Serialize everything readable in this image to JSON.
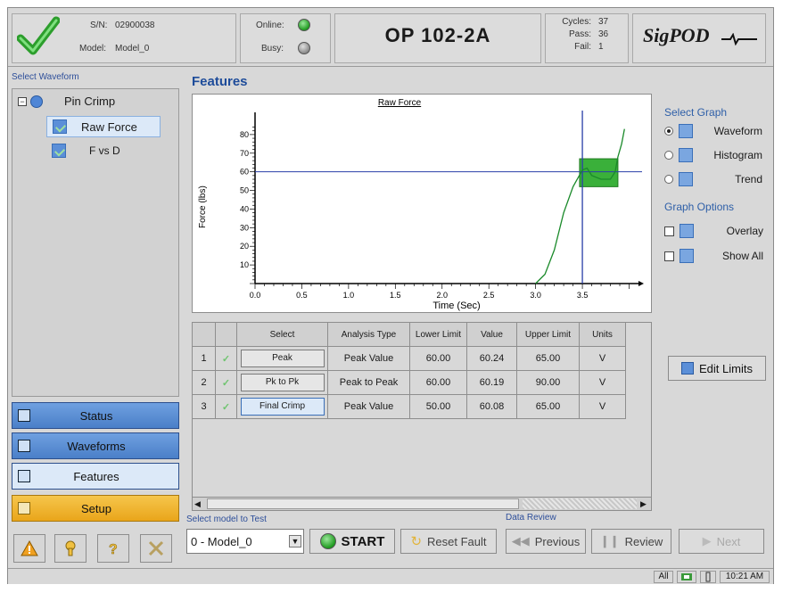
{
  "header": {
    "serial_label": "S/N:",
    "serial_value": "02900038",
    "model_label": "Model:",
    "model_value": "Model_0",
    "online_label": "Online:",
    "busy_label": "Busy:",
    "station_title": "OP 102-2A",
    "cycles_label": "Cycles:",
    "cycles_value": "37",
    "pass_label": "Pass:",
    "pass_value": "36",
    "fail_label": "Fail:",
    "fail_value": "1",
    "logo_text": "SigPOD"
  },
  "sidebar": {
    "select_waveform_label": "Select Waveform",
    "tree": {
      "root": "Pin Crimp",
      "items": [
        "Raw Force",
        "F vs D"
      ]
    },
    "nav": {
      "status": "Status",
      "waveforms": "Waveforms",
      "features": "Features",
      "setup": "Setup"
    }
  },
  "main": {
    "title": "Features",
    "graph_options": {
      "select_graph_label": "Select Graph",
      "waveform": "Waveform",
      "histogram": "Histogram",
      "trend": "Trend",
      "graph_options_label": "Graph Options",
      "overlay": "Overlay",
      "show_all": "Show All"
    },
    "table": {
      "headers": [
        "Select",
        "Analysis Type",
        "Lower Limit",
        "Value",
        "Upper Limit",
        "Units"
      ],
      "rows": [
        {
          "n": "1",
          "select": "Peak",
          "type": "Peak Value",
          "lower": "60.00",
          "value": "60.24",
          "upper": "65.00",
          "units": "V"
        },
        {
          "n": "2",
          "select": "Pk to Pk",
          "type": "Peak to Peak",
          "lower": "60.00",
          "value": "60.19",
          "upper": "90.00",
          "units": "V"
        },
        {
          "n": "3",
          "select": "Final Crimp",
          "type": "Peak Value",
          "lower": "50.00",
          "value": "60.08",
          "upper": "65.00",
          "units": "V"
        }
      ]
    },
    "edit_limits": "Edit Limits"
  },
  "bottom": {
    "select_model_label": "Select model to Test",
    "model_selected": "0 - Model_0",
    "start": "START",
    "reset_fault": "Reset Fault",
    "data_review_label": "Data Review",
    "previous": "Previous",
    "review": "Review",
    "next": "Next"
  },
  "statusbar": {
    "mode": "All",
    "time": "10:21 AM"
  },
  "chart_data": {
    "type": "line",
    "title": "Raw Force",
    "xlabel": "Time (Sec)",
    "ylabel": "Force (lbs)",
    "xlim": [
      0.0,
      4.1
    ],
    "ylim": [
      0,
      90
    ],
    "x_ticks": [
      "0.0",
      "0.5",
      "1.0",
      "1.5",
      "2.0",
      "2.5",
      "3.0",
      "3.5"
    ],
    "y_ticks": [
      "10",
      "20",
      "30",
      "40",
      "50",
      "60",
      "70",
      "80"
    ],
    "cursor_x": 3.5,
    "cursor_y": 60,
    "window": {
      "x0": 3.47,
      "x1": 3.88,
      "y0": 52,
      "y1": 67
    },
    "series": [
      {
        "x": [
          3.0,
          3.1,
          3.2,
          3.3,
          3.4,
          3.5,
          3.55,
          3.6,
          3.7,
          3.8,
          3.85,
          3.88,
          3.92,
          3.95
        ],
        "y": [
          0,
          5,
          18,
          38,
          52,
          61,
          62,
          58,
          56,
          56,
          60,
          68,
          75,
          83
        ]
      }
    ]
  }
}
